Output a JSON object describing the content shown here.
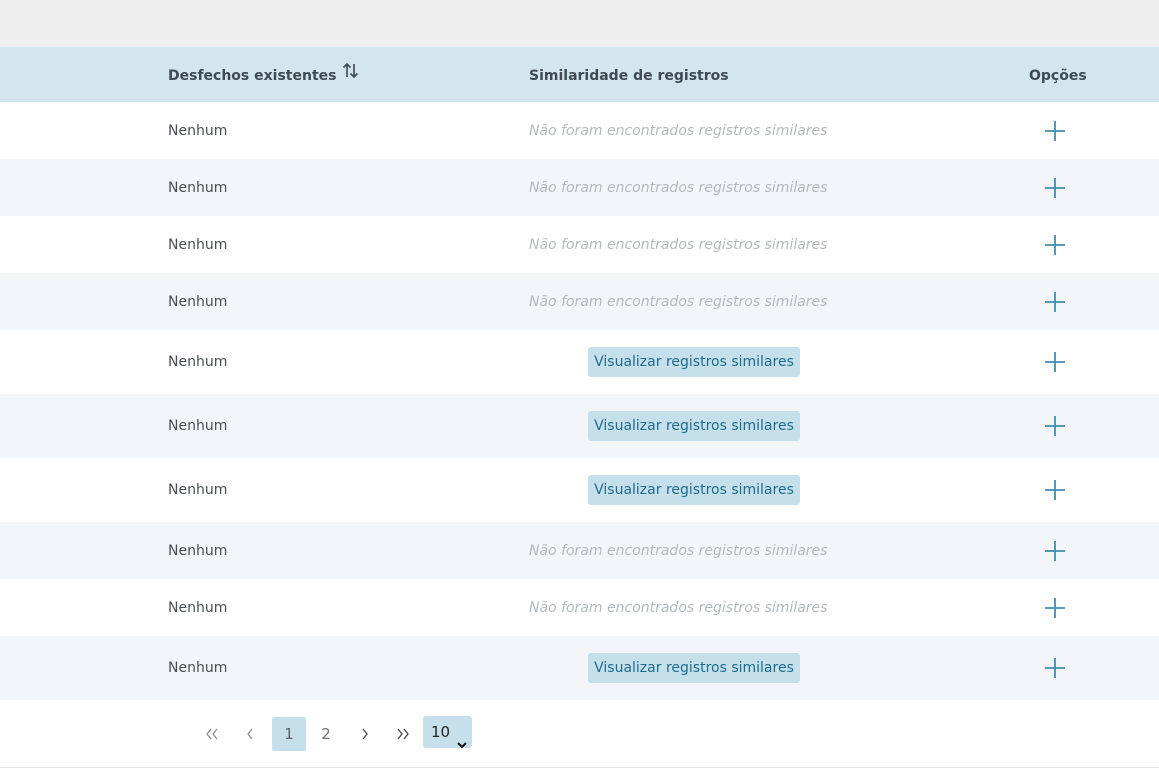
{
  "table": {
    "columns": {
      "desfechos": "Desfechos existentes",
      "similaridade": "Similaridade de registros",
      "opcoes": "Opções"
    },
    "rows": [
      {
        "desfecho": "Nenhum",
        "type": "none",
        "similar_text": "Não foram encontrados registros similares"
      },
      {
        "desfecho": "Nenhum",
        "type": "none",
        "similar_text": "Não foram encontrados registros similares"
      },
      {
        "desfecho": "Nenhum",
        "type": "none",
        "similar_text": "Não foram encontrados registros similares"
      },
      {
        "desfecho": "Nenhum",
        "type": "none",
        "similar_text": "Não foram encontrados registros similares"
      },
      {
        "desfecho": "Nenhum",
        "type": "button",
        "similar_text": "Visualizar registros similares"
      },
      {
        "desfecho": "Nenhum",
        "type": "button",
        "similar_text": "Visualizar registros similares"
      },
      {
        "desfecho": "Nenhum",
        "type": "button",
        "similar_text": "Visualizar registros similares"
      },
      {
        "desfecho": "Nenhum",
        "type": "none",
        "similar_text": "Não foram encontrados registros similares"
      },
      {
        "desfecho": "Nenhum",
        "type": "none",
        "similar_text": "Não foram encontrados registros similares"
      },
      {
        "desfecho": "Nenhum",
        "type": "button",
        "similar_text": "Visualizar registros similares"
      }
    ],
    "row_icon": "plus-icon",
    "sort_icon": "sort-arrows-icon"
  },
  "pagination": {
    "pages": [
      "1",
      "2"
    ],
    "current_page": "1",
    "per_page": "10",
    "icons": {
      "first": "double-chevron-left-icon",
      "prev": "chevron-left-icon",
      "next": "chevron-right-icon",
      "last": "double-chevron-right-icon"
    }
  },
  "colors": {
    "header_bg": "#d3e6ee",
    "accent": "#3f8eb0",
    "button_bg": "#c5e0ea",
    "button_text": "#1f6c8e",
    "stripe": "#f2f6f8"
  }
}
